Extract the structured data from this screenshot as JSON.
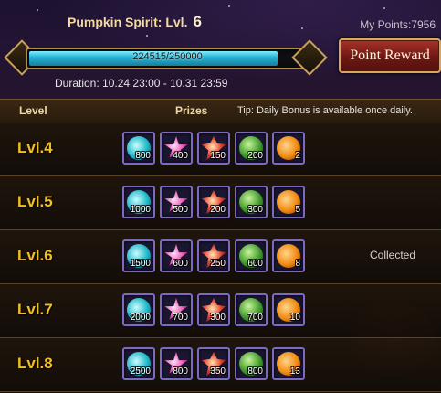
{
  "header": {
    "title": "Pumpkin Spirit: Lvl.",
    "level": "6",
    "points": "My Points:7956",
    "progress_text": "224515/250000",
    "progress_fraction": 0.898,
    "duration": "Duration: 10.24 23:00 - 10.31 23:59",
    "reward_button": "Point Reward"
  },
  "columns": {
    "level": "Level",
    "prizes": "Prizes",
    "tip": "Tip: Daily Bonus is available once daily."
  },
  "rows": [
    {
      "level": "Lvl.4",
      "status": "",
      "prizes": [
        {
          "icon": "cyan-orb-icon",
          "qty": "800"
        },
        {
          "icon": "pink-star-icon",
          "qty": "400"
        },
        {
          "icon": "red-crystal-icon",
          "qty": "150"
        },
        {
          "icon": "green-melon-icon",
          "qty": "200"
        },
        {
          "icon": "pumpkin-icon",
          "qty": "2"
        }
      ]
    },
    {
      "level": "Lvl.5",
      "status": "",
      "prizes": [
        {
          "icon": "cyan-orb-icon",
          "qty": "1000"
        },
        {
          "icon": "pink-star-icon",
          "qty": "500"
        },
        {
          "icon": "red-crystal-icon",
          "qty": "200"
        },
        {
          "icon": "green-melon-icon",
          "qty": "300"
        },
        {
          "icon": "pumpkin-icon",
          "qty": "5"
        }
      ]
    },
    {
      "level": "Lvl.6",
      "status": "Collected",
      "prizes": [
        {
          "icon": "cyan-orb-icon",
          "qty": "1500"
        },
        {
          "icon": "pink-star-icon",
          "qty": "600"
        },
        {
          "icon": "red-crystal-icon",
          "qty": "250"
        },
        {
          "icon": "green-melon-icon",
          "qty": "600"
        },
        {
          "icon": "pumpkin-icon",
          "qty": "8"
        }
      ]
    },
    {
      "level": "Lvl.7",
      "status": "",
      "prizes": [
        {
          "icon": "cyan-orb-icon",
          "qty": "2000"
        },
        {
          "icon": "pink-star-icon",
          "qty": "700"
        },
        {
          "icon": "red-crystal-icon",
          "qty": "300"
        },
        {
          "icon": "green-melon-icon",
          "qty": "700"
        },
        {
          "icon": "pumpkin-icon",
          "qty": "10"
        }
      ]
    },
    {
      "level": "Lvl.8",
      "status": "",
      "prizes": [
        {
          "icon": "cyan-orb-icon",
          "qty": "2500"
        },
        {
          "icon": "pink-star-icon",
          "qty": "800"
        },
        {
          "icon": "red-crystal-icon",
          "qty": "350"
        },
        {
          "icon": "green-melon-icon",
          "qty": "800"
        },
        {
          "icon": "pumpkin-icon",
          "qty": "13"
        }
      ]
    }
  ]
}
